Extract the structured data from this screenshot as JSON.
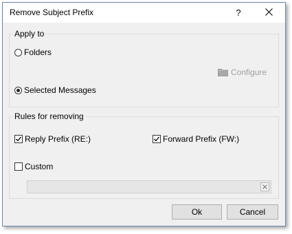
{
  "window": {
    "title": "Remove Subject Prefix",
    "help_label": "?"
  },
  "apply_to": {
    "label": "Apply to",
    "options": [
      {
        "label": "Folders",
        "selected": false
      },
      {
        "label": "Selected Messages",
        "selected": true
      }
    ],
    "configure_label": "Configure"
  },
  "rules": {
    "label": "Rules for removing",
    "reply_prefix": {
      "label": "Reply Prefix (RE:)",
      "checked": true
    },
    "forward_prefix": {
      "label": "Forward Prefix (FW:)",
      "checked": true
    },
    "custom": {
      "label": "Custom",
      "checked": false
    },
    "custom_value": ""
  },
  "buttons": {
    "ok": "Ok",
    "cancel": "Cancel"
  },
  "colors": {
    "dialog_bg": "#f0f0f0",
    "border": "#6e86b0",
    "disabled_text": "#a0a0a0"
  }
}
